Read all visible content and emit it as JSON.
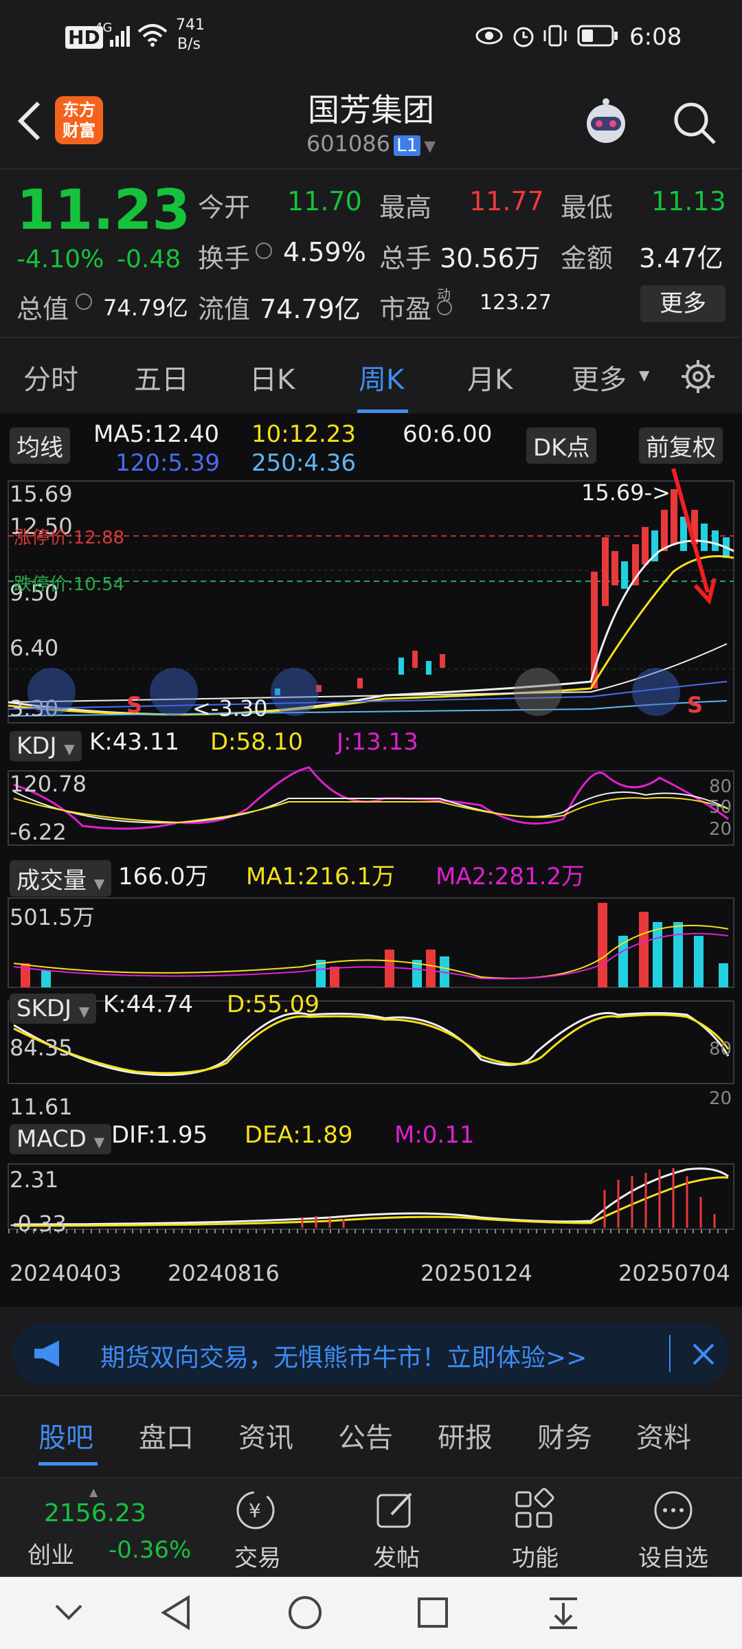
{
  "status_bar": {
    "hd": "HD",
    "signal": "4G",
    "speed_value": "741",
    "speed_unit": "B/s",
    "time": "6:08"
  },
  "header": {
    "logo_line1": "东方",
    "logo_line2": "财富",
    "title": "国芳集团",
    "code": "601086",
    "level": "L1"
  },
  "quote": {
    "price": "11.23",
    "change_pct": "-4.10%",
    "change": "-0.48",
    "open_label": "今开",
    "open": "11.70",
    "high_label": "最高",
    "high": "11.77",
    "low_label": "最低",
    "low": "11.13",
    "turnover_label": "换手",
    "turnover": "4.59%",
    "volume_label": "总手",
    "volume": "30.56万",
    "amount_label": "金额",
    "amount": "3.47亿",
    "mcap_label": "总值",
    "mcap": "74.79亿",
    "float_label": "流值",
    "float": "74.79亿",
    "pe_label": "市盈",
    "pe_sup": "动",
    "pe": "123.27",
    "more_label": "更多"
  },
  "tabs": [
    "分时",
    "五日",
    "日K",
    "周K",
    "月K",
    "更多"
  ],
  "chart": {
    "ma_button": "均线",
    "ma5": "MA5:12.40",
    "ma10": "10:12.23",
    "ma60": "60:6.00",
    "ma120": "120:5.39",
    "ma250": "250:4.36",
    "dk_button": "DK点",
    "adj_button": "前复权",
    "price_axis": [
      "15.69",
      "12.50",
      "9.50",
      "6.40",
      "3.30"
    ],
    "limit_up": "涨停价:12.88",
    "limit_down": "跌停价:10.54",
    "high_marker": "15.69->",
    "low_marker": "<-3.30",
    "signal_s": "S",
    "kdj": {
      "name": "KDJ",
      "k": "K:43.11",
      "d": "D:58.10",
      "j": "J:13.13",
      "axis_top": "120.78",
      "axis_bottom": "-6.22",
      "r1": "80",
      "r2": "50",
      "r3": "20"
    },
    "vol": {
      "name": "成交量",
      "v": "166.0万",
      "ma1": "MA1:216.1万",
      "ma2": "MA2:281.2万",
      "axis_top": "501.5万"
    },
    "skdj": {
      "name": "SKDJ",
      "k": "K:44.74",
      "d": "D:55.09",
      "axis_top": "84.35",
      "axis_bottom": "11.61",
      "r1": "80",
      "r2": "20"
    },
    "macd": {
      "name": "MACD",
      "dif": "DIF:1.95",
      "dea": "DEA:1.89",
      "m": "M:0.11",
      "axis_top": "2.31",
      "axis_bottom": "-0.33"
    },
    "dates": [
      "20240403",
      "20240816",
      "20250124",
      "20250704"
    ]
  },
  "banner": {
    "text": "期货双向交易，无惧熊市牛市！立即体验>>"
  },
  "subtabs": [
    "股吧",
    "盘口",
    "资讯",
    "公告",
    "研报",
    "财务",
    "资料"
  ],
  "bottom": {
    "index_value": "2156.23",
    "index_name": "创业",
    "index_change": "-0.36%",
    "trade": "交易",
    "post": "发帖",
    "func": "功能",
    "fav": "设自选"
  }
}
